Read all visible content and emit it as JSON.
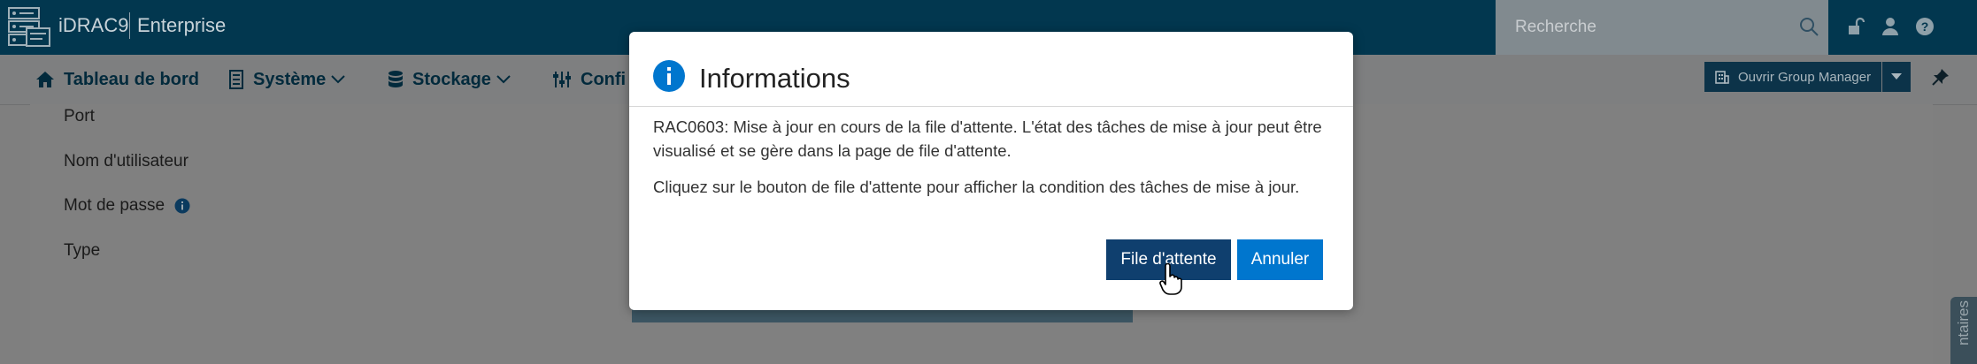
{
  "header": {
    "product": "iDRAC9",
    "edition": "Enterprise",
    "search_placeholder": "Recherche",
    "icons": [
      "search-icon",
      "unlock-icon",
      "user-icon",
      "help-icon"
    ]
  },
  "nav": {
    "items": [
      {
        "label": "Tableau de bord",
        "icon": "home-icon"
      },
      {
        "label": "Système",
        "icon": "server-icon"
      },
      {
        "label": "Stockage",
        "icon": "database-icon"
      },
      {
        "label": "Confi",
        "icon": "sliders-icon"
      }
    ],
    "group_manager_label": "Ouvrir Group Manager"
  },
  "form": {
    "fields": [
      "Port",
      "Nom d'utilisateur",
      "Mot de passe",
      "Type"
    ]
  },
  "side_tab": {
    "label": "ntaires"
  },
  "modal": {
    "title": "Informations",
    "message_1": "RAC0603: Mise à jour en cours de la file d'attente. L'état des tâches de mise à jour peut être visualisé et se gère dans la page de file d'attente.",
    "message_2": "Cliquez sur le bouton de file d'attente pour afficher la condition des tâches de mise à jour.",
    "primary_button": "File d'attente",
    "secondary_button": "Annuler"
  },
  "colors": {
    "header_bg": "#02374f",
    "primary_button": "#0f3f6e",
    "secondary_button": "#0076ce",
    "info_icon": "#0076ce"
  }
}
